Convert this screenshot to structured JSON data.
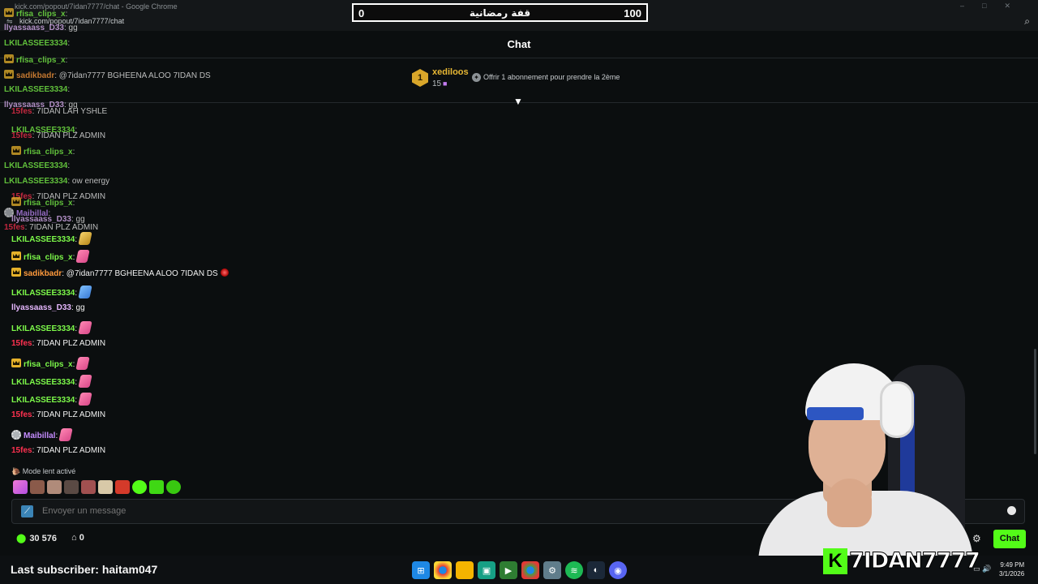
{
  "browser": {
    "window_title": "kick.com/popout/7idan7777/chat - Google Chrome",
    "url": "kick.com/popout/7idan7777/chat",
    "url_icon": "⇋",
    "zoom_icon": "zoom-icon"
  },
  "goal": {
    "min": "0",
    "title": "قفة رمضانية",
    "max": "100"
  },
  "chat_header": {
    "title": "Chat"
  },
  "pinned": {
    "rank": "1",
    "gifter": "xediloos",
    "count": "15",
    "offer": "Offrir 1 abonnement pour prendre la 2ème"
  },
  "ghost_messages": [
    {
      "user": "rfisa_clips_x",
      "text": ":",
      "color": "green",
      "badge": "crown"
    },
    {
      "user": "llyassaass_D33",
      "text": ": gg",
      "color": "lilac",
      "badge": ""
    },
    {
      "user": "LKILASSEE3334",
      "text": ":",
      "color": "green",
      "badge": ""
    },
    {
      "user": "rfisa_clips_x",
      "text": ":",
      "color": "green",
      "badge": "crown"
    },
    {
      "user": "sadikbadr",
      "text": ": @7idan7777 BGHEENA ALOO 7IDAN DS",
      "color": "orange",
      "badge": "crown"
    },
    {
      "user": "LKILASSEE3334",
      "text": ":",
      "color": "green",
      "badge": ""
    },
    {
      "user": "llyassaass_D33",
      "text": ": gg",
      "color": "lilac",
      "badge": ""
    },
    {
      "user": "15fes",
      "text": ": 7IDAN LAH YSHLE",
      "color": "red",
      "badge": ""
    },
    {
      "user": "LKILASSEE3334",
      "text": ":",
      "color": "green",
      "badge": ""
    },
    {
      "user": "15fes",
      "text": ": 7IDAN PLZ ADMIN",
      "color": "red",
      "badge": ""
    },
    {
      "user": "rfisa_clips_x",
      "text": ":",
      "color": "green",
      "badge": "crown"
    },
    {
      "user": "LKILASSEE3334",
      "text": ":",
      "color": "green",
      "badge": ""
    },
    {
      "user": "LKILASSEE3334",
      "text": ": ow energy",
      "color": "green",
      "badge": ""
    },
    {
      "user": "15fes",
      "text": ": 7IDAN PLZ ADMIN",
      "color": "red",
      "badge": ""
    },
    {
      "user": "rfisa_clips_x",
      "text": ":",
      "color": "green",
      "badge": "crown"
    },
    {
      "user": "Maibillal",
      "text": ":",
      "color": "violet",
      "badge": "gear"
    },
    {
      "user": "llyassaass_D33",
      "text": ": gg",
      "color": "lilac",
      "badge": ""
    },
    {
      "user": "15fes",
      "text": ": 7IDAN PLZ ADMIN",
      "color": "red",
      "badge": ""
    }
  ],
  "messages": [
    {
      "user": "LKILASSEE3334",
      "text": ":",
      "color": "green",
      "badge": "",
      "emote": "gold"
    },
    {
      "user": "rfisa_clips_x",
      "text": ":",
      "color": "green",
      "badge": "crown",
      "emote": "pink"
    },
    {
      "user": "sadikbadr",
      "text": ": @7idan7777 BGHEENA ALOO 7IDAN DS",
      "color": "orange",
      "badge": "crown",
      "emote": "red"
    },
    {
      "user": "LKILASSEE3334",
      "text": ":",
      "color": "green",
      "badge": "",
      "emote": "blue"
    },
    {
      "user": "llyassaass_D33",
      "text": ": gg",
      "color": "lilac",
      "badge": "",
      "emote": ""
    },
    {
      "user": "LKILASSEE3334",
      "text": ":",
      "color": "green",
      "badge": "",
      "emote": "pink"
    },
    {
      "user": "15fes",
      "text": ": 7IDAN PLZ ADMIN",
      "color": "red",
      "badge": "",
      "emote": ""
    },
    {
      "user": "rfisa_clips_x",
      "text": ":",
      "color": "green",
      "badge": "crown",
      "emote": "pink"
    },
    {
      "user": "LKILASSEE3334",
      "text": ":",
      "color": "green",
      "badge": "",
      "emote": "pink"
    },
    {
      "user": "LKILASSEE3334",
      "text": ":",
      "color": "green",
      "badge": "",
      "emote": "pink"
    },
    {
      "user": "15fes",
      "text": ": 7IDAN PLZ ADMIN",
      "color": "red",
      "badge": "",
      "emote": ""
    },
    {
      "user": "Maibillal",
      "text": ":",
      "color": "violet",
      "badge": "gear",
      "emote": "pink"
    },
    {
      "user": "15fes",
      "text": ": 7IDAN PLZ ADMIN",
      "color": "red",
      "badge": "",
      "emote": ""
    }
  ],
  "slow_mode": "Mode lent activé",
  "input": {
    "placeholder": "Envoyer un message"
  },
  "points": {
    "value": "30 576",
    "store_count": "0"
  },
  "chat_button": "Chat",
  "last_subscriber": "Last subscriber: haitam047",
  "streamer_overlay": {
    "k": "K",
    "name": "7IDAN7777"
  },
  "clock": {
    "time": "9:49 PM",
    "date": "3/1/2026"
  },
  "colors": {
    "kick_green": "#53fc18",
    "accent_gold": "#e6b12a"
  }
}
